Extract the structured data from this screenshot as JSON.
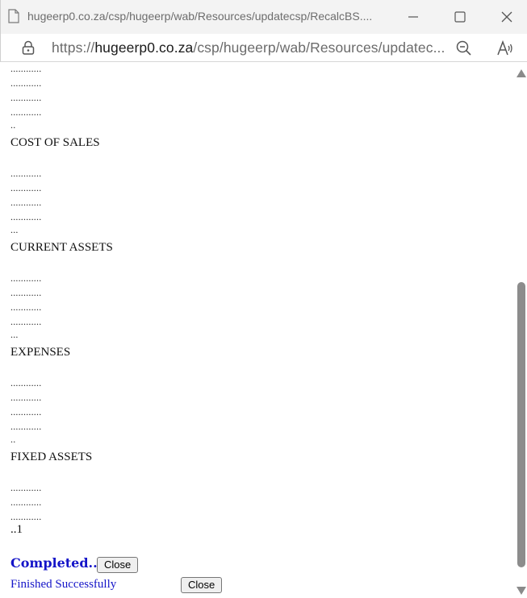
{
  "window": {
    "title": "hugeerp0.co.za/csp/hugeerp/wab/Resources/updatecsp/RecalcBS....",
    "controls": {
      "minimize": "minimize-icon",
      "maximize": "maximize-icon",
      "close": "close-icon"
    }
  },
  "address_bar": {
    "scheme": "https://",
    "host": "hugeerp0.co.za",
    "path": "/csp/hugeerp/wab/Resources/updatec...",
    "icons": [
      "lock-icon",
      "zoom-out-icon",
      "read-aloud-icon"
    ]
  },
  "content": {
    "lines": [
      {
        "text": "............",
        "kind": "dots"
      },
      {
        "text": "............",
        "kind": "dots"
      },
      {
        "text": "............",
        "kind": "dots"
      },
      {
        "text": "............",
        "kind": "dots"
      },
      {
        "text": "..",
        "kind": "dots"
      },
      {
        "text": "COST OF SALES",
        "kind": "heading"
      },
      {
        "text": "............",
        "kind": "dots"
      },
      {
        "text": "............",
        "kind": "dots"
      },
      {
        "text": "............",
        "kind": "dots"
      },
      {
        "text": "............",
        "kind": "dots"
      },
      {
        "text": "...",
        "kind": "dots"
      },
      {
        "text": "CURRENT ASSETS",
        "kind": "heading"
      },
      {
        "text": "............",
        "kind": "dots"
      },
      {
        "text": "............",
        "kind": "dots"
      },
      {
        "text": "............",
        "kind": "dots"
      },
      {
        "text": "............",
        "kind": "dots"
      },
      {
        "text": "...",
        "kind": "dots"
      },
      {
        "text": "EXPENSES",
        "kind": "heading"
      },
      {
        "text": "............",
        "kind": "dots"
      },
      {
        "text": "............",
        "kind": "dots"
      },
      {
        "text": "............",
        "kind": "dots"
      },
      {
        "text": "............",
        "kind": "dots"
      },
      {
        "text": "..",
        "kind": "dots"
      },
      {
        "text": "FIXED ASSETS",
        "kind": "heading"
      },
      {
        "text": "............",
        "kind": "dots"
      },
      {
        "text": "............",
        "kind": "dots"
      },
      {
        "text": "............",
        "kind": "dots"
      },
      {
        "text": "..1",
        "kind": "heading"
      }
    ],
    "completed_text": "Completed..",
    "close_button_1": "Close",
    "finished_text": "Finished Successfully",
    "close_button_2": "Close",
    "status_color": "#1414c8"
  },
  "scrollbar": {
    "thumb_position": 0.45
  }
}
